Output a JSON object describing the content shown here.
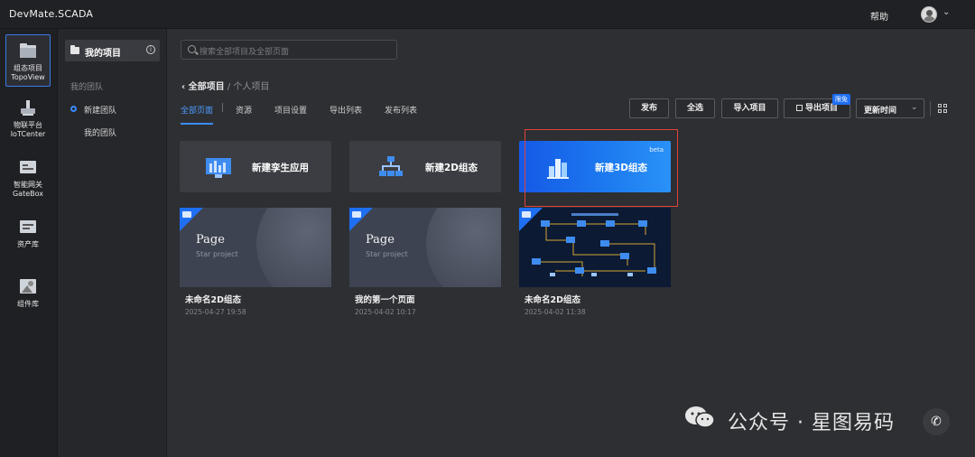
{
  "app": {
    "title": "DevMate.SCADA",
    "help": "帮助"
  },
  "rail": {
    "items": [
      {
        "line1": "组态项目",
        "line2": "TopoView"
      },
      {
        "line1": "物联平台",
        "line2": "IoTCenter"
      },
      {
        "line1": "智能网关",
        "line2": "GateBox"
      },
      {
        "line1": "资产库",
        "line2": ""
      },
      {
        "line1": "组件库",
        "line2": ""
      }
    ]
  },
  "projects_panel": {
    "my_projects": "我的项目",
    "teams_header": "我的团队",
    "new_team": "新建团队",
    "my_team": "我的团队"
  },
  "search": {
    "placeholder": "搜索全部项目及全部页面"
  },
  "breadcrumb": {
    "back": "全部项目",
    "sep": "/",
    "current": "个人项目"
  },
  "tabs": [
    {
      "label": "全部页面",
      "active": true
    },
    {
      "label": "资源"
    },
    {
      "label": "项目设置"
    },
    {
      "label": "导出列表"
    },
    {
      "label": "发布列表"
    }
  ],
  "toolbar": {
    "publish": "发布",
    "select_all": "全选",
    "import": "导入项目",
    "export": "导出项目",
    "export_badge": "限免",
    "sort": "更新时间"
  },
  "create_cards": [
    {
      "label": "新建孪生应用"
    },
    {
      "label": "新建2D组态"
    },
    {
      "label": "新建3D组态",
      "badge": "beta"
    }
  ],
  "project_cards": [
    {
      "title": "未命名2D组态",
      "date": "2025-04-27 19:58",
      "thumb_title": "Page",
      "thumb_sub": "Star project"
    },
    {
      "title": "我的第一个页面",
      "date": "2025-04-02 10:17",
      "thumb_title": "Page",
      "thumb_sub": "Star project"
    },
    {
      "title": "未命名2D组态",
      "date": "2025-04-02 11:38"
    }
  ],
  "watermark": {
    "text": "公众号 · 星图易码"
  },
  "colors": {
    "accent": "#3b8cff",
    "highlight": "#e0433a",
    "background": "#2e2f33"
  }
}
